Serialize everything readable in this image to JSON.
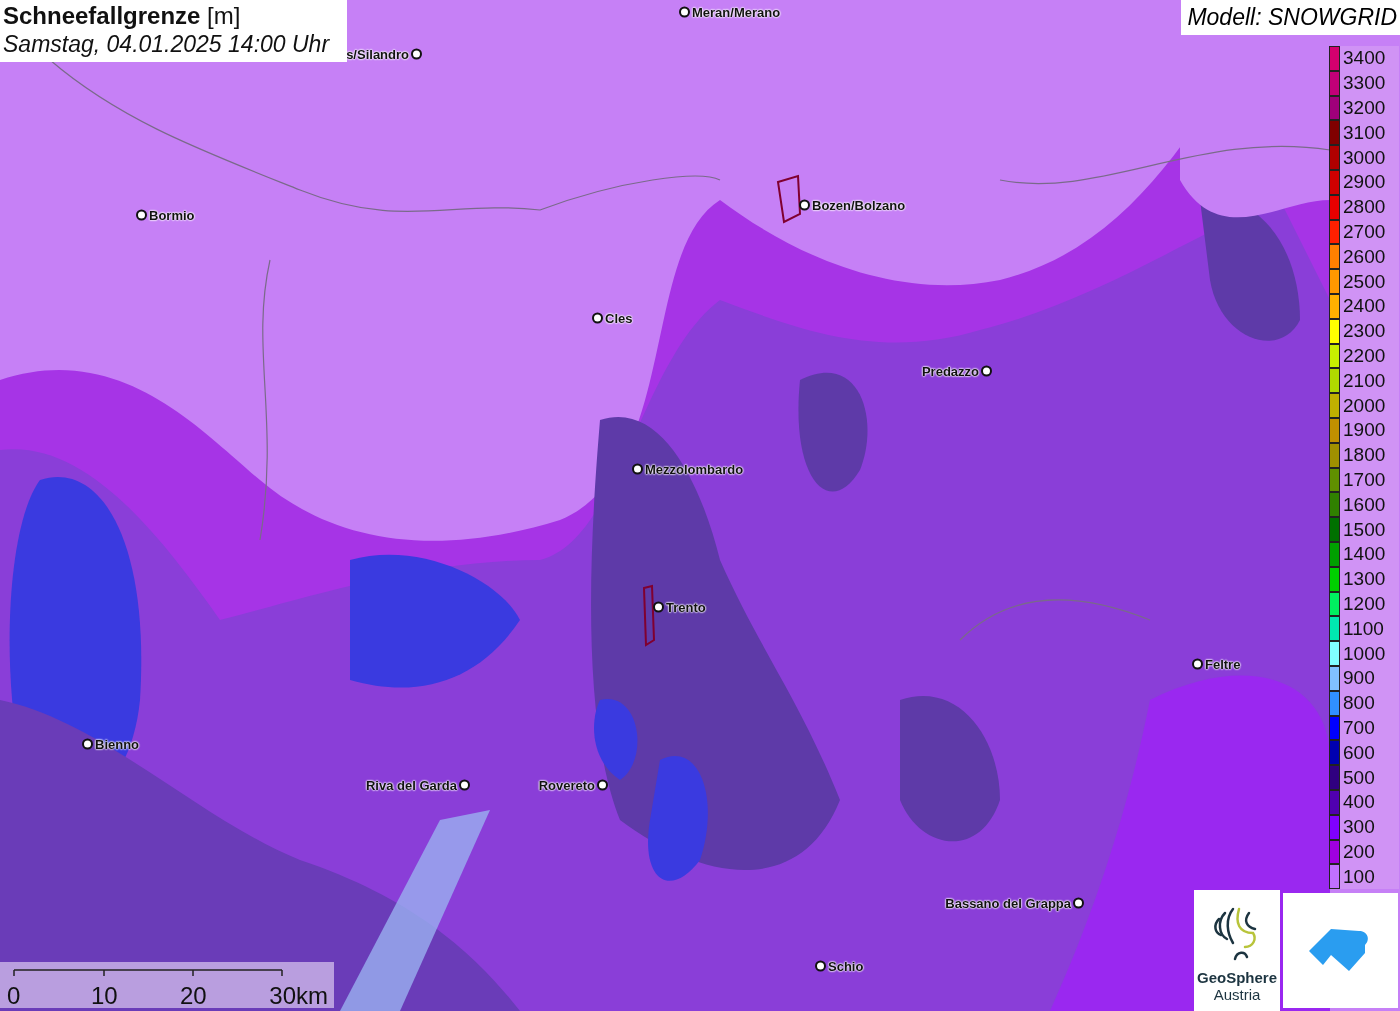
{
  "title": {
    "name": "Schneefallgrenze",
    "unit": "[m]",
    "datetime": "Samstag, 04.01.2025 14:00 Uhr"
  },
  "model_label": "Modell: SNOWGRID",
  "cities": [
    {
      "name": "Meran/Merano",
      "label_left": false
    },
    {
      "name": "s/Silandro",
      "label_left": true
    },
    {
      "name": "Bormio",
      "label_left": false
    },
    {
      "name": "Bozen/Bolzano",
      "label_left": false
    },
    {
      "name": "Cles",
      "label_left": false
    },
    {
      "name": "Predazzo",
      "label_left": true
    },
    {
      "name": "Mezzolombardo",
      "label_left": false
    },
    {
      "name": "Trento",
      "label_left": false
    },
    {
      "name": "Feltre",
      "label_left": false
    },
    {
      "name": "Bienno",
      "label_left": false
    },
    {
      "name": "Riva del Garda",
      "label_left": true
    },
    {
      "name": "Rovereto",
      "label_left": true
    },
    {
      "name": "Bassano del Grappa",
      "label_left": true
    },
    {
      "name": "Schio",
      "label_left": false
    }
  ],
  "legend": [
    {
      "label": "3400",
      "color": "#d4006e"
    },
    {
      "label": "3300",
      "color": "#c20078"
    },
    {
      "label": "3200",
      "color": "#a0007a"
    },
    {
      "label": "3100",
      "color": "#800000"
    },
    {
      "label": "3000",
      "color": "#b00000"
    },
    {
      "label": "2900",
      "color": "#d00000"
    },
    {
      "label": "2800",
      "color": "#e80000"
    },
    {
      "label": "2700",
      "color": "#ff2000"
    },
    {
      "label": "2600",
      "color": "#ff8000"
    },
    {
      "label": "2500",
      "color": "#ff9800"
    },
    {
      "label": "2400",
      "color": "#ffb000"
    },
    {
      "label": "2300",
      "color": "#ffff00"
    },
    {
      "label": "2200",
      "color": "#c8f000"
    },
    {
      "label": "2100",
      "color": "#b0d800"
    },
    {
      "label": "2000",
      "color": "#c0b000"
    },
    {
      "label": "1900",
      "color": "#c09000"
    },
    {
      "label": "1800",
      "color": "#a09000"
    },
    {
      "label": "1700",
      "color": "#609000"
    },
    {
      "label": "1600",
      "color": "#308000"
    },
    {
      "label": "1500",
      "color": "#007000"
    },
    {
      "label": "1400",
      "color": "#00a000"
    },
    {
      "label": "1300",
      "color": "#00d000"
    },
    {
      "label": "1200",
      "color": "#00f060"
    },
    {
      "label": "1100",
      "color": "#00e8b0"
    },
    {
      "label": "1000",
      "color": "#80ffff"
    },
    {
      "label": "900",
      "color": "#80c0ff"
    },
    {
      "label": "800",
      "color": "#3090ff"
    },
    {
      "label": "700",
      "color": "#0000ff"
    },
    {
      "label": "600",
      "color": "#0000b0"
    },
    {
      "label": "500",
      "color": "#300080"
    },
    {
      "label": "400",
      "color": "#5000b0"
    },
    {
      "label": "300",
      "color": "#8000ff"
    },
    {
      "label": "200",
      "color": "#a000e0"
    },
    {
      "label": "100",
      "color": "#c070ff"
    }
  ],
  "scale_bar": {
    "ticks": [
      "0",
      "10",
      "20",
      "30km"
    ]
  },
  "logos": {
    "geosphere": [
      "GeoSphere",
      "Austria"
    ]
  }
}
